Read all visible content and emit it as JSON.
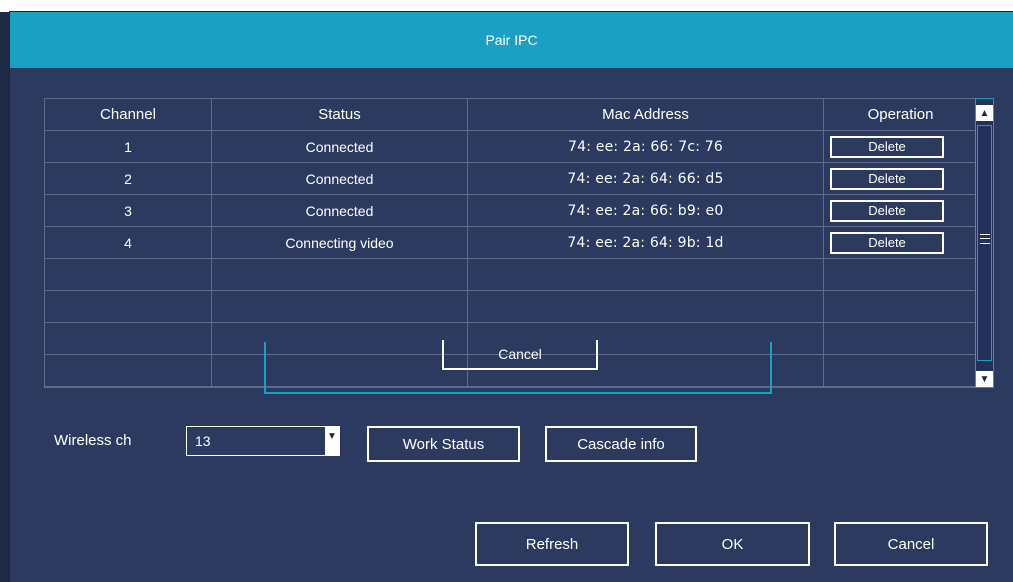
{
  "window": {
    "title": "Pair IPC"
  },
  "table": {
    "headers": [
      "Channel",
      "Status",
      "Mac Address",
      "Operation"
    ],
    "rows": [
      {
        "channel": "1",
        "status": "Connected",
        "mac": "74: ee: 2a: 66: 7c: 76",
        "operation": "Delete"
      },
      {
        "channel": "2",
        "status": "Connected",
        "mac": "74: ee: 2a: 64: 66: d5",
        "operation": "Delete"
      },
      {
        "channel": "3",
        "status": "Connected",
        "mac": "74: ee: 2a: 66: b9: e0",
        "operation": "Delete"
      },
      {
        "channel": "4",
        "status": "Connecting video",
        "mac": "74: ee: 2a: 64: 9b: 1d",
        "operation": "Delete"
      }
    ]
  },
  "overlay": {
    "cancel_label": "Cancel"
  },
  "wireless": {
    "label": "Wireless ch",
    "value": "13"
  },
  "buttons": {
    "work_status": "Work Status",
    "cascade_info": "Cascade info",
    "refresh": "Refresh",
    "ok": "OK",
    "cancel": "Cancel"
  },
  "colors": {
    "titlebar": "#1aa0c2",
    "panel": "#2b3a5e",
    "accent": "#1aa0c2"
  },
  "icons": {
    "scroll_up": "triangle-up-icon",
    "scroll_down": "triangle-down-icon",
    "dropdown": "triangle-down-icon"
  }
}
